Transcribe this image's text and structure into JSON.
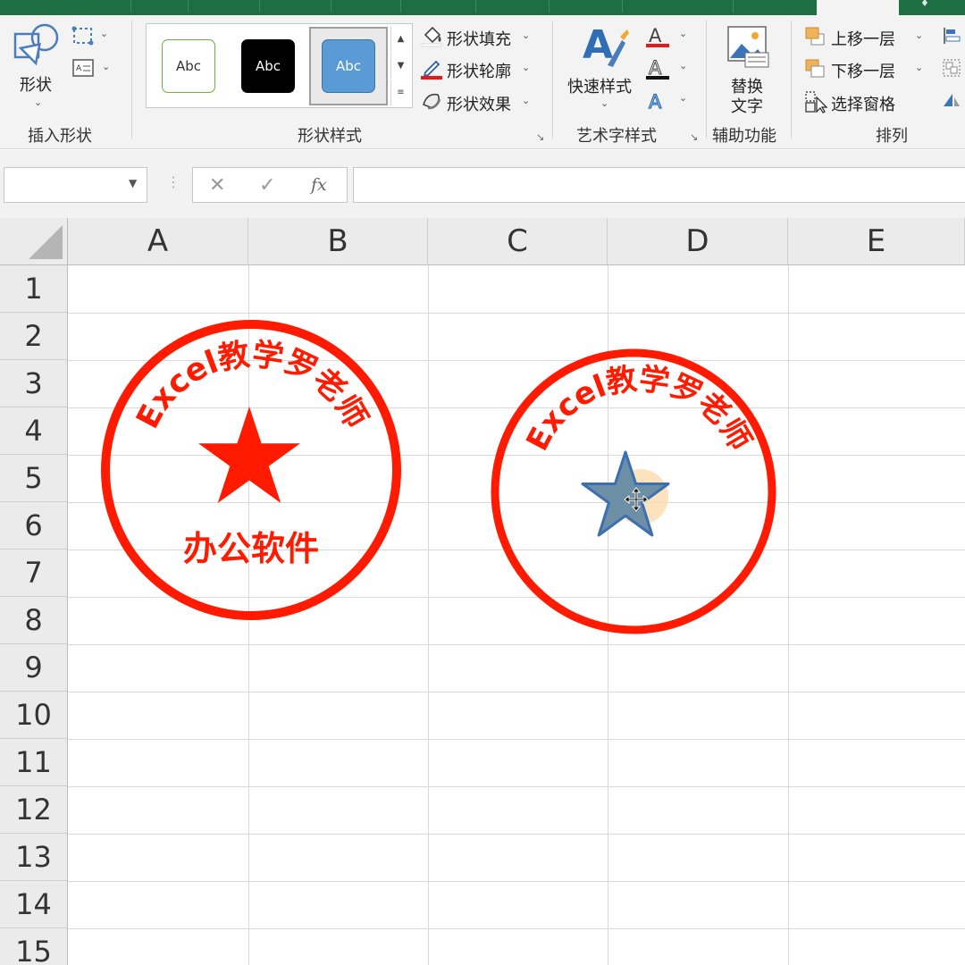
{
  "ribbon": {
    "insert_shapes": {
      "shapes_label": "形状",
      "group_label": "插入形状"
    },
    "shape_styles": {
      "group_label": "形状样式",
      "gallery": [
        {
          "label": "Abc",
          "fill": "#ffffff",
          "border": "#70ad47",
          "text": "#333333"
        },
        {
          "label": "Abc",
          "fill": "#000000",
          "border": "#000000",
          "text": "#ffffff"
        },
        {
          "label": "Abc",
          "fill": "#5b9bd5",
          "border": "#41719c",
          "text": "#ffffff"
        }
      ],
      "fill_label": "形状填充",
      "outline_label": "形状轮廓",
      "effects_label": "形状效果"
    },
    "wordart": {
      "quick_styles_label": "快速样式",
      "group_label": "艺术字样式"
    },
    "accessibility": {
      "alt_text_label_1": "替换",
      "alt_text_label_2": "文字",
      "group_label": "辅助功能"
    },
    "arrange": {
      "bring_forward_label": "上移一层",
      "send_backward_label": "下移一层",
      "selection_pane_label": "选择窗格",
      "group_label": "排列"
    }
  },
  "formula_bar": {
    "name_box": "",
    "formula": "",
    "fx_label": "fx"
  },
  "columns": [
    "A",
    "B",
    "C",
    "D",
    "E"
  ],
  "rows": [
    "1",
    "2",
    "3",
    "4",
    "5",
    "6",
    "7",
    "8",
    "9",
    "10",
    "11",
    "12",
    "13",
    "14",
    "15"
  ],
  "seals": [
    {
      "arc_text": "Excel教学罗老师",
      "bottom_text": "办公软件",
      "color": "#ff1a00"
    },
    {
      "arc_text": "Excel教学罗老师",
      "color": "#ff1a00",
      "star_fill": "#6d8fa6",
      "star_outline": "#3b6fb1"
    }
  ],
  "colors": {
    "excel_green": "#1e6e43",
    "ribbon_bg": "#f3f3f3"
  }
}
